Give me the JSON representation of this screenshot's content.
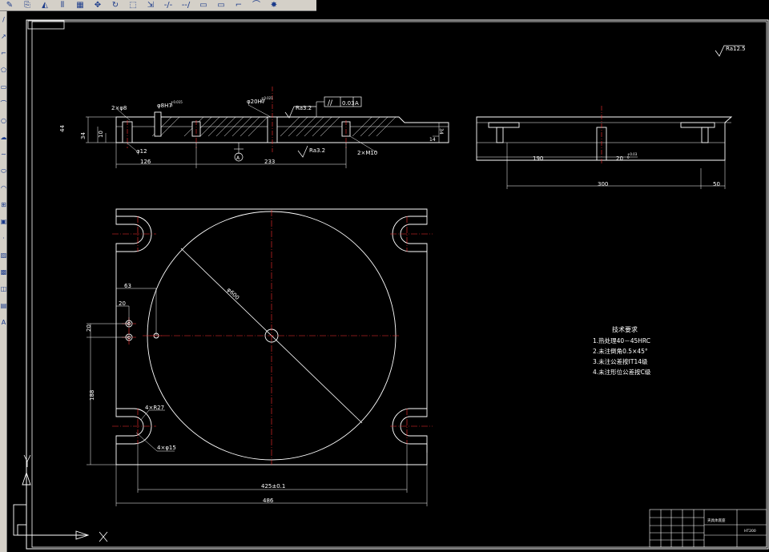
{
  "toolbar": {
    "buttons": [
      {
        "name": "pencil-icon",
        "glyph": "✎"
      },
      {
        "name": "copy-icon",
        "glyph": "⎘"
      },
      {
        "name": "mirror-icon",
        "glyph": "◭"
      },
      {
        "name": "offset-icon",
        "glyph": "⫴"
      },
      {
        "name": "array-icon",
        "glyph": "▦"
      },
      {
        "name": "move-icon",
        "glyph": "✥"
      },
      {
        "name": "rotate-icon",
        "glyph": "↻"
      },
      {
        "name": "scale-icon",
        "glyph": "⬚"
      },
      {
        "name": "stretch-icon",
        "glyph": "⇲"
      },
      {
        "name": "trim-icon",
        "glyph": "-/-"
      },
      {
        "name": "extend-icon",
        "glyph": "--/"
      },
      {
        "name": "break-icon",
        "glyph": "▭"
      },
      {
        "name": "join-icon",
        "glyph": "▭"
      },
      {
        "name": "chamfer-icon",
        "glyph": "⌐"
      },
      {
        "name": "fillet-icon",
        "glyph": "⌒"
      },
      {
        "name": "explode-icon",
        "glyph": "✸"
      }
    ]
  },
  "sidebar": {
    "buttons": [
      {
        "name": "line-icon",
        "glyph": "/"
      },
      {
        "name": "construction-line-icon",
        "glyph": "↗"
      },
      {
        "name": "polyline-icon",
        "glyph": "⌐"
      },
      {
        "name": "polygon-icon",
        "glyph": "⬠"
      },
      {
        "name": "rectangle-icon",
        "glyph": "▭"
      },
      {
        "name": "arc-icon",
        "glyph": "⌒"
      },
      {
        "name": "circle-icon",
        "glyph": "○"
      },
      {
        "name": "revision-cloud-icon",
        "glyph": "☁"
      },
      {
        "name": "spline-icon",
        "glyph": "∼"
      },
      {
        "name": "ellipse-icon",
        "glyph": "⬭"
      },
      {
        "name": "ellipse-arc-icon",
        "glyph": "◠"
      },
      {
        "name": "insert-block-icon",
        "glyph": "⊞"
      },
      {
        "name": "make-block-icon",
        "glyph": "▣"
      },
      {
        "name": "point-icon",
        "glyph": "·"
      },
      {
        "name": "hatch-icon",
        "glyph": "▨"
      },
      {
        "name": "gradient-icon",
        "glyph": "▩"
      },
      {
        "name": "region-icon",
        "glyph": "◫"
      },
      {
        "name": "table-icon",
        "glyph": "▤"
      },
      {
        "name": "mtext-icon",
        "glyph": "A"
      }
    ]
  },
  "drawing": {
    "roughness_global": "Ra12.5",
    "section_view": {
      "dim_44": "44",
      "dim_34_left": "34",
      "dim_10": "10",
      "hole_2x8": "2×φ8",
      "hole_8h7": "φ8H7",
      "hole_8h7_tol": "+0.015\n0",
      "center_bore": "φ20H7",
      "center_bore_tol": "+0.021\n0",
      "roughness_top": "Ra3.2",
      "parallelism_symbol": "//",
      "parallelism_value": "0.03",
      "datum_ref": "A",
      "dim_phi12": "φ12",
      "roughness_bottom": "Ra3.2",
      "thread": "2×M10",
      "dim_126": "126",
      "dim_233": "233",
      "datum_label": "A",
      "dim_34_right": "34",
      "dim_14": "14"
    },
    "side_view": {
      "dim_190": "190",
      "dim_20h7": "20",
      "dim_20h7_tol": "+0.03\n0",
      "dim_300": "300",
      "dim_50": "50"
    },
    "plan_view": {
      "dia_600": "φ600",
      "dim_63": "63",
      "dim_20_h": "20",
      "dim_20_v": "20",
      "dim_188": "188",
      "slot_r27": "4×R27",
      "slot_15": "4×φ15",
      "dim_425": "425±0.1",
      "dim_486": "486"
    },
    "notes": {
      "title": "技术要求",
      "items": [
        "1.热处理40－45HRC",
        "2.未注倒角0.5×45°",
        "3.未注公差按IT14级",
        "4.未注形位公差按C级"
      ]
    },
    "title_block": {
      "part_name": "夹具体底座",
      "material": "HT200"
    }
  }
}
